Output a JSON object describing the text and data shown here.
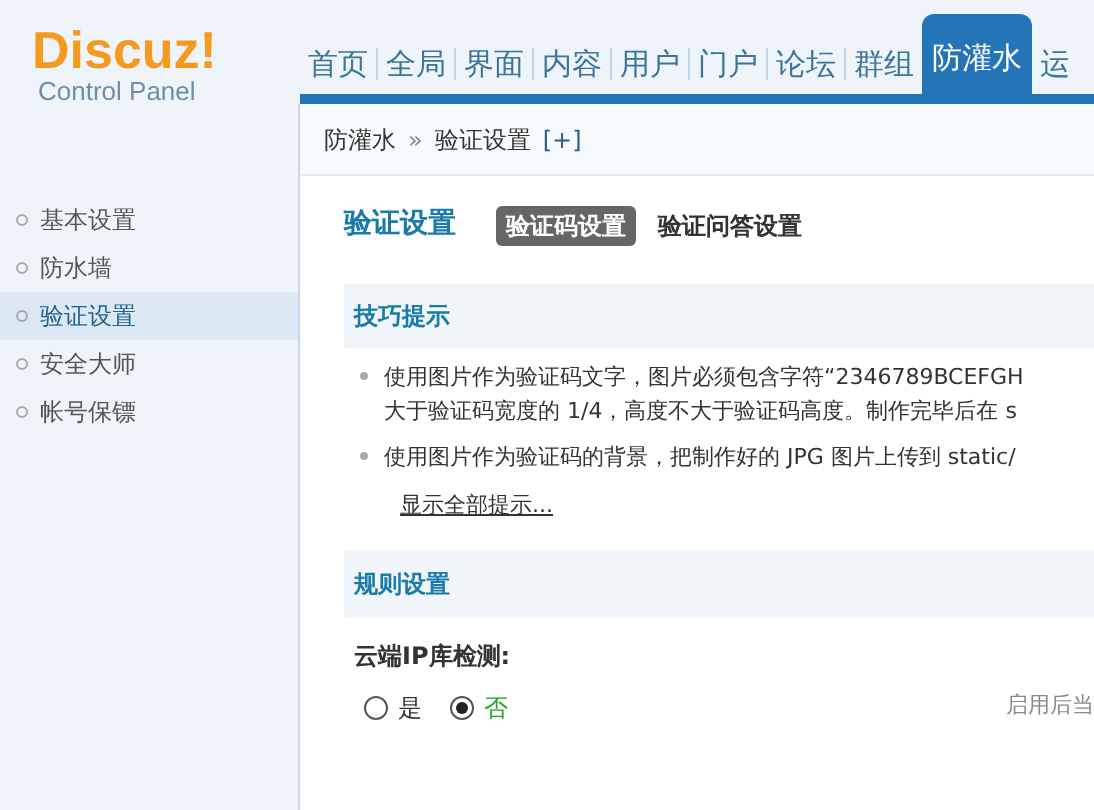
{
  "logo": {
    "name": "Discuz!",
    "subtitle": "Control Panel"
  },
  "nav": [
    {
      "label": "首页",
      "selected": false
    },
    {
      "label": "全局",
      "selected": false
    },
    {
      "label": "界面",
      "selected": false
    },
    {
      "label": "内容",
      "selected": false
    },
    {
      "label": "用户",
      "selected": false
    },
    {
      "label": "门户",
      "selected": false
    },
    {
      "label": "论坛",
      "selected": false
    },
    {
      "label": "群组",
      "selected": false
    },
    {
      "label": "防灌水",
      "selected": true
    },
    {
      "label": "运",
      "selected": false
    }
  ],
  "breadcrumb": {
    "parent": "防灌水",
    "separator": "»",
    "current": "验证设置",
    "add": "[+]"
  },
  "sidebar": {
    "items": [
      {
        "label": "基本设置",
        "selected": false
      },
      {
        "label": "防水墙",
        "selected": false
      },
      {
        "label": "验证设置",
        "selected": true
      },
      {
        "label": "安全大师",
        "selected": false
      },
      {
        "label": "帐号保镖",
        "selected": false
      }
    ]
  },
  "page_title": "验证设置",
  "tabs": [
    {
      "label": "验证码设置",
      "selected": true
    },
    {
      "label": "验证问答设置",
      "selected": false
    }
  ],
  "tips": {
    "title": "技巧提示",
    "items": [
      [
        "使用图片作为验证码文字，图片必须包含字符“2346789BCEFGH",
        "大于验证码宽度的 1/4，高度不大于验证码高度。制作完毕后在 s"
      ],
      [
        "使用图片作为验证码的背景，把制作好的 JPG 图片上传到 static/"
      ]
    ],
    "show_all": "显示全部提示..."
  },
  "rules": {
    "title": "规则设置",
    "field_label": "云端IP库检测:",
    "options": [
      {
        "label": "是",
        "selected": false
      },
      {
        "label": "否",
        "selected": true
      }
    ],
    "note": "启用后当"
  }
}
